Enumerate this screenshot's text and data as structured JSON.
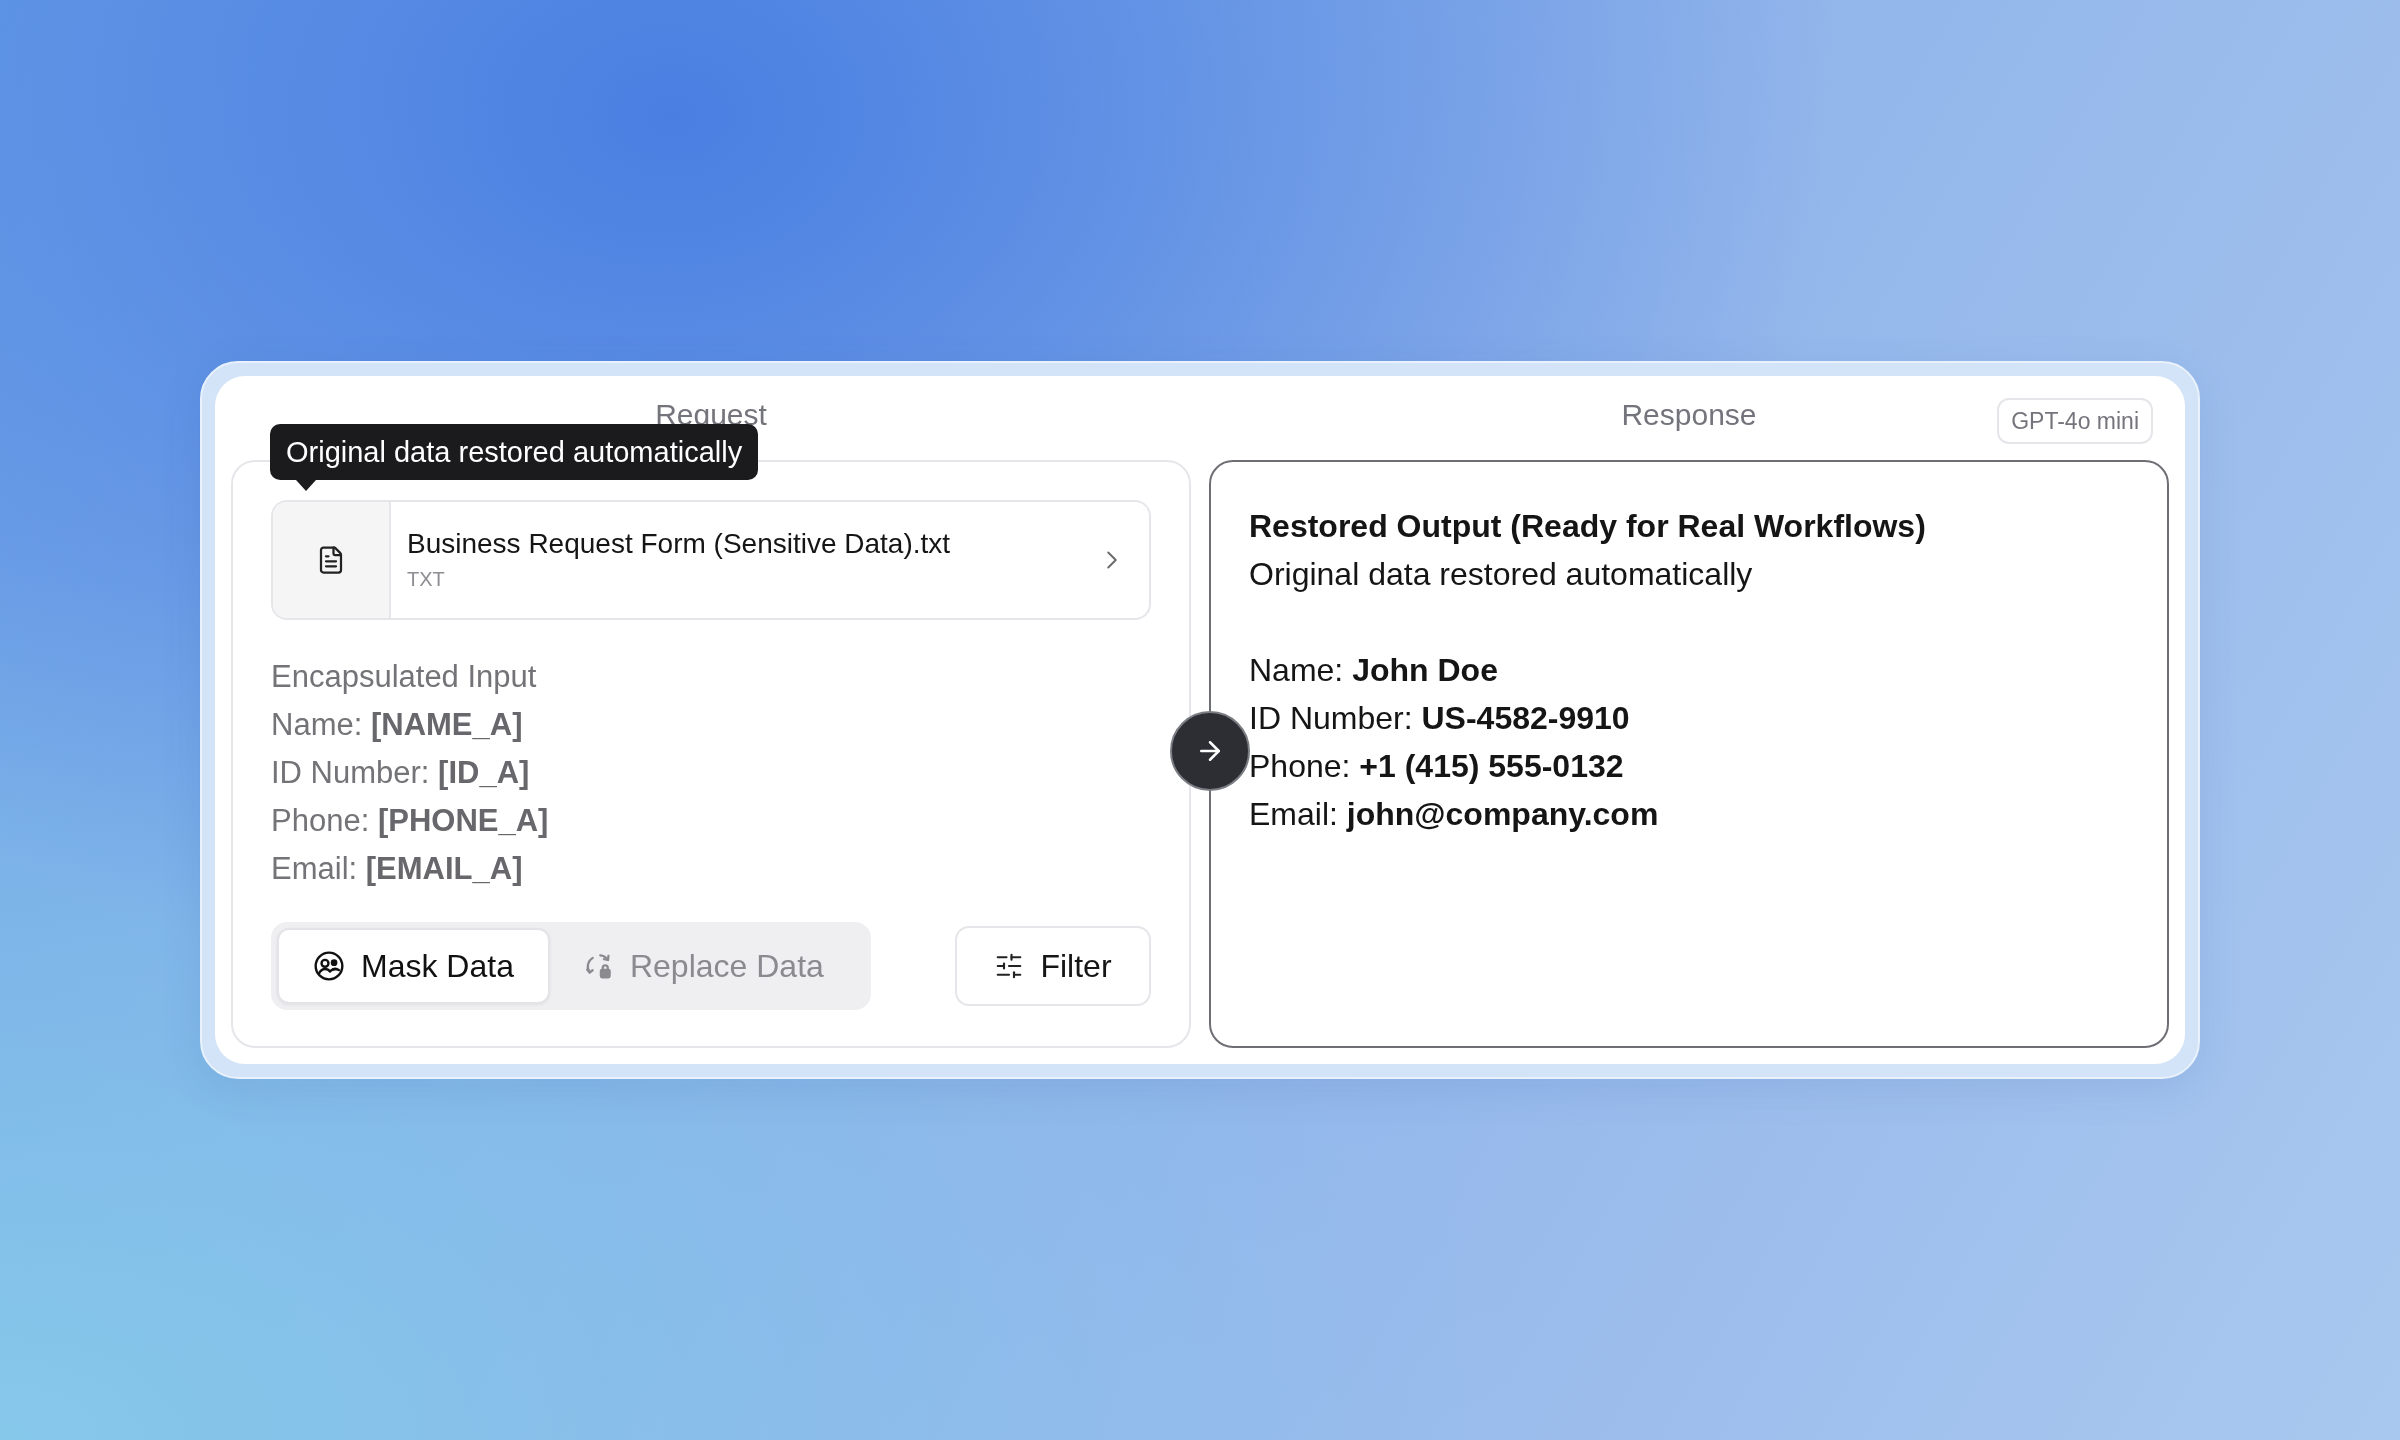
{
  "request": {
    "title": "Request",
    "tooltip": "Original data restored automatically",
    "file": {
      "name": "Business Request Form (Sensitive Data).txt",
      "type": "TXT"
    },
    "input_heading": "Encapsulated Input",
    "fields": [
      {
        "label": "Name:",
        "value": "[NAME_A]"
      },
      {
        "label": "ID Number:",
        "value": "[ID_A]"
      },
      {
        "label": "Phone:",
        "value": "[PHONE_A]"
      },
      {
        "label": "Email:",
        "value": "[EMAIL_A]"
      }
    ],
    "modes": [
      {
        "kind": "mask",
        "label": "Mask Data",
        "selected": true
      },
      {
        "kind": "replace",
        "label": "Replace Data",
        "selected": false
      }
    ],
    "filter_button": "Filter"
  },
  "response": {
    "title": "Response",
    "model_badge": "GPT-4o mini",
    "heading": "Restored Output (Ready for Real Workflows)",
    "subheading": "Original data restored automatically",
    "fields": [
      {
        "label": "Name:",
        "value": "John Doe"
      },
      {
        "label": "ID Number:",
        "value": "US-4582-9910"
      },
      {
        "label": "Phone:",
        "value": "+1 (415) 555-0132"
      },
      {
        "label": "Email:",
        "value": "john@company.com"
      }
    ]
  }
}
